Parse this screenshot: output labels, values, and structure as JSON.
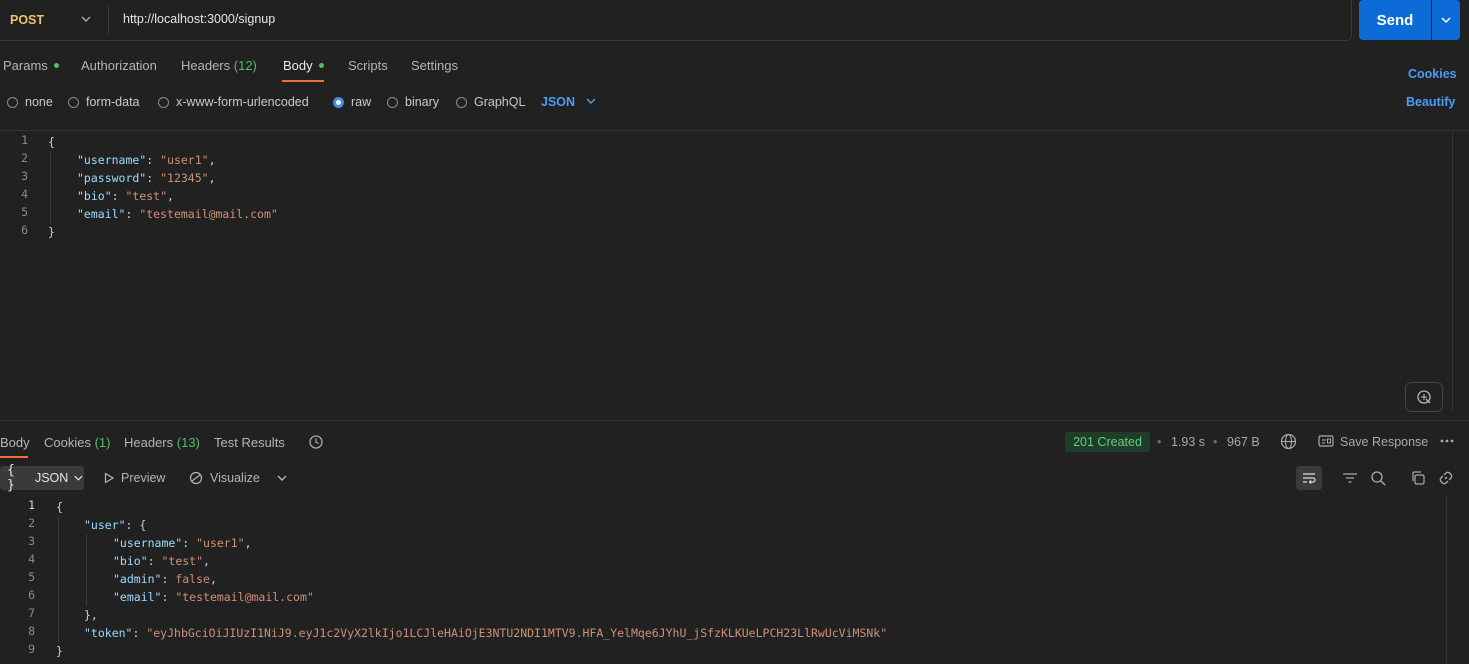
{
  "request": {
    "method": "POST",
    "url": "http://localhost:3000/signup",
    "send_label": "Send"
  },
  "request_tabs": {
    "params": "Params",
    "authorization": "Authorization",
    "headers": "Headers",
    "headers_count": "(12)",
    "body": "Body",
    "scripts": "Scripts",
    "settings": "Settings",
    "cookies": "Cookies",
    "beautify": "Beautify"
  },
  "body_types": {
    "none": "none",
    "form_data": "form-data",
    "urlencoded": "x-www-form-urlencoded",
    "raw": "raw",
    "binary": "binary",
    "graphql": "GraphQL",
    "format": "JSON"
  },
  "request_body": {
    "line_numbers": [
      "1",
      "2",
      "3",
      "4",
      "5",
      "6"
    ],
    "open": "{",
    "close": "}",
    "fields": [
      {
        "key": "\"username\"",
        "value": "\"user1\"",
        "sep": ","
      },
      {
        "key": "\"password\"",
        "value": "\"12345\"",
        "sep": ","
      },
      {
        "key": "\"bio\"",
        "value": "\"test\"",
        "sep": ","
      },
      {
        "key": "\"email\"",
        "value": "\"testemail@mail.com\"",
        "sep": ""
      }
    ]
  },
  "response_tabs": {
    "body": "Body",
    "cookies": "Cookies",
    "cookies_count": "(1)",
    "headers": "Headers",
    "headers_count": "(13)",
    "test_results": "Test Results",
    "status": "201 Created",
    "time": "1.93 s",
    "size": "967 B",
    "save_response": "Save Response"
  },
  "response_toolbar": {
    "format": "JSON",
    "preview": "Preview",
    "visualize": "Visualize"
  },
  "response_body": {
    "line_numbers": [
      "1",
      "2",
      "3",
      "4",
      "5",
      "6",
      "7",
      "8",
      "9"
    ],
    "open": "{",
    "user_key": "\"user\"",
    "user_open": "{",
    "fields": [
      {
        "key": "\"username\"",
        "value": "\"user1\"",
        "sep": ",",
        "kind": "str"
      },
      {
        "key": "\"bio\"",
        "value": "\"test\"",
        "sep": ",",
        "kind": "str"
      },
      {
        "key": "\"admin\"",
        "value": "false",
        "sep": ",",
        "kind": "kw"
      },
      {
        "key": "\"email\"",
        "value": "\"testemail@mail.com\"",
        "sep": "",
        "kind": "str"
      }
    ],
    "user_close": "},",
    "token_key": "\"token\"",
    "token_value": "\"eyJhbGciOiJIUzI1NiJ9.eyJ1c2VyX2lkIjo1LCJleHAiOjE3NTU2NDI1MTV9.HFA_YelMqe6JYhU_jSfzKLKUeLPCH23LlRwUcViMSNk\"",
    "close": "}"
  },
  "colors": {
    "accent": "#f26b3a",
    "send": "#0c6bd6",
    "success": "#5fd07f",
    "method": "#f0c36a"
  }
}
